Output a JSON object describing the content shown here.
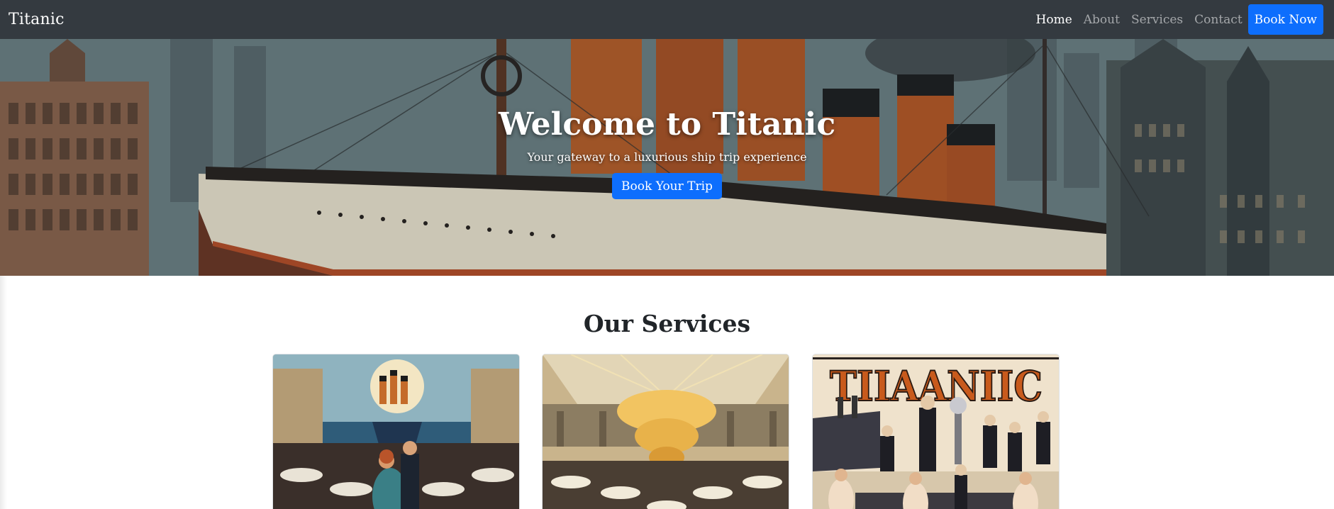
{
  "navbar": {
    "brand": "Titanic",
    "links": [
      {
        "label": "Home",
        "active": true
      },
      {
        "label": "About",
        "active": false
      },
      {
        "label": "Services",
        "active": false
      },
      {
        "label": "Contact",
        "active": false
      }
    ],
    "cta_label": "Book Now"
  },
  "hero": {
    "title": "Welcome to Titanic",
    "subtitle": "Your gateway to a luxurious ship trip experience",
    "button_label": "Book Your Trip"
  },
  "services": {
    "title": "Our Services",
    "cards": [
      {
        "image": "ballroom-dance-illustration"
      },
      {
        "image": "chandelier-dining-hall-illustration"
      },
      {
        "image": "titanic-poster-illustration",
        "poster_text": "TIIAANIIC"
      }
    ]
  },
  "colors": {
    "navbar_bg": "#343a40",
    "primary": "#0d6efd",
    "text": "#212529"
  }
}
